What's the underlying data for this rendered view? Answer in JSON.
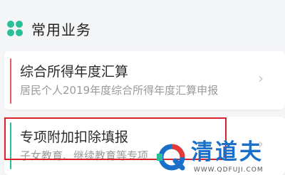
{
  "section": {
    "title": "常用业务",
    "icon": "grid-apps-icon",
    "accent_color": "#2bbf97"
  },
  "cards": [
    {
      "title": "综合所得年度汇算",
      "subtitle": "居民个人2019年度综合所得年度汇算申报",
      "accent_color": "#e75a69",
      "chevron": "›"
    },
    {
      "title": "专项附加扣除填报",
      "subtitle": "子女教育、继续教育等专项",
      "accent_color": "#2bbf97",
      "chevron": "›",
      "highlighted": true
    }
  ],
  "watermark": {
    "brand": "清道夫",
    "url": "WWW.QDFUJI.COM",
    "brand_color": "#1a6fc9"
  }
}
